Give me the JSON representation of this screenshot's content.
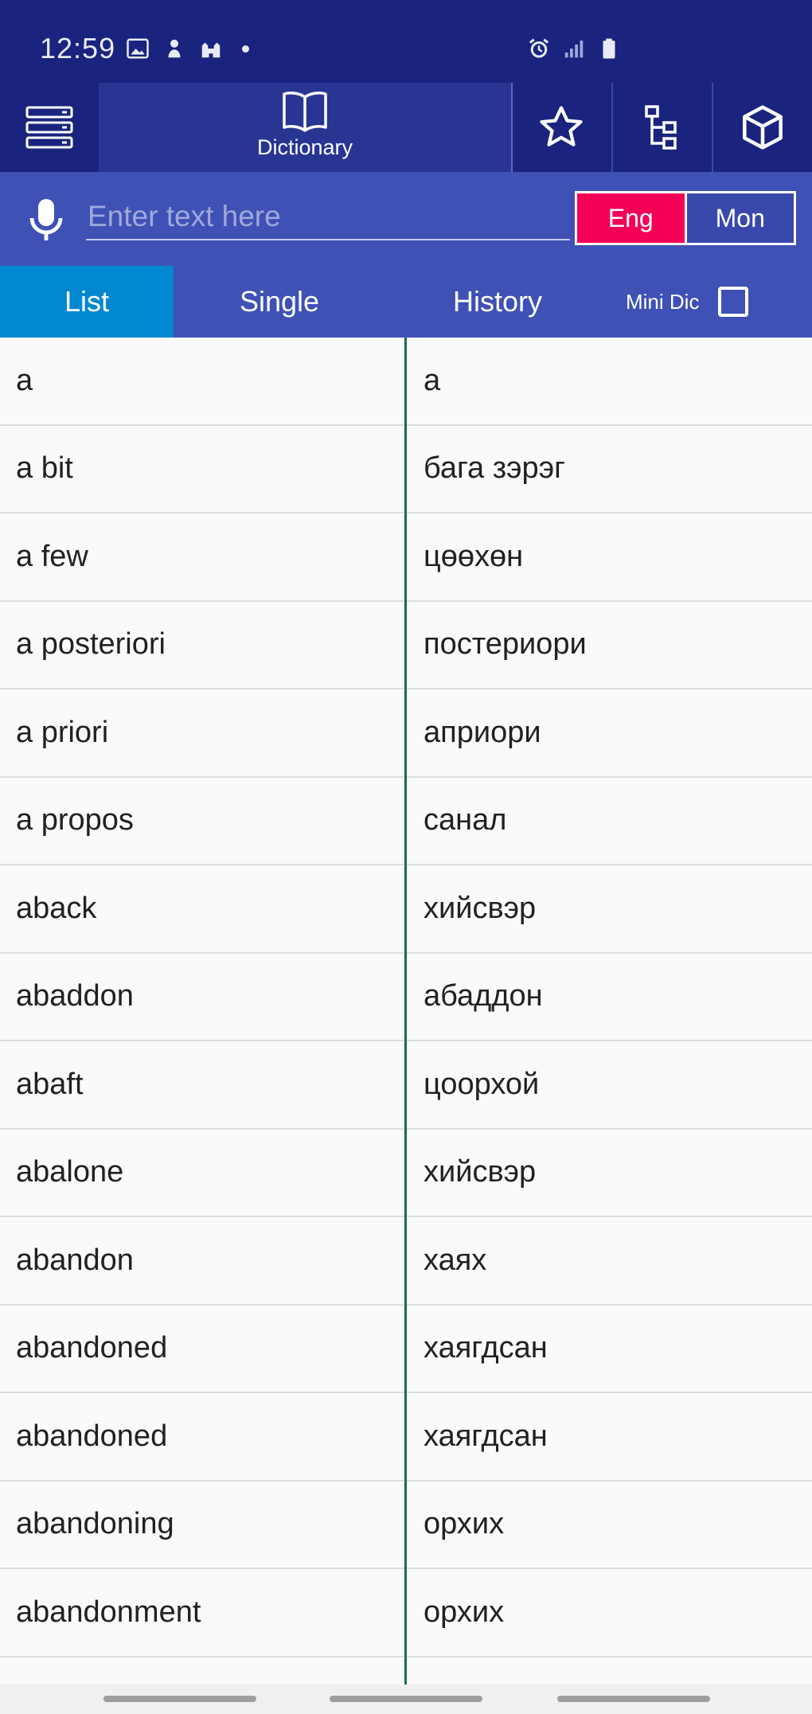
{
  "status": {
    "time": "12:59"
  },
  "toolbar": {
    "dictionary_label": "Dictionary"
  },
  "search": {
    "placeholder": "Enter text here",
    "value": ""
  },
  "lang": {
    "eng": "Eng",
    "mon": "Mon",
    "selected": "Eng"
  },
  "tabs": {
    "list": "List",
    "single": "Single",
    "history": "History",
    "mini_dic": "Mini Dic",
    "active": "List",
    "mini_dic_checked": false
  },
  "colors": {
    "primary_dark": "#1a237e",
    "primary": "#3f51b5",
    "accent": "#f50057",
    "tab_active": "#0288d1",
    "divider": "#1e6b52"
  },
  "entries": [
    {
      "en": "a",
      "mn": "а"
    },
    {
      "en": "a bit",
      "mn": "бага зэрэг"
    },
    {
      "en": "a few",
      "mn": "цөөхөн"
    },
    {
      "en": "a posteriori",
      "mn": "постериори"
    },
    {
      "en": "a priori",
      "mn": "априори"
    },
    {
      "en": "a propos",
      "mn": "санал"
    },
    {
      "en": "aback",
      "mn": "хийсвэр"
    },
    {
      "en": "abaddon",
      "mn": "абаддон"
    },
    {
      "en": "abaft",
      "mn": "цоорхой"
    },
    {
      "en": "abalone",
      "mn": "хийсвэр"
    },
    {
      "en": "abandon",
      "mn": "хаях"
    },
    {
      "en": "abandoned",
      "mn": "хаягдсан"
    },
    {
      "en": "abandoned",
      "mn": "хаягдсан"
    },
    {
      "en": "abandoning",
      "mn": "орхих"
    },
    {
      "en": "abandonment",
      "mn": "орхих"
    },
    {
      "en": "",
      "mn": ""
    }
  ]
}
